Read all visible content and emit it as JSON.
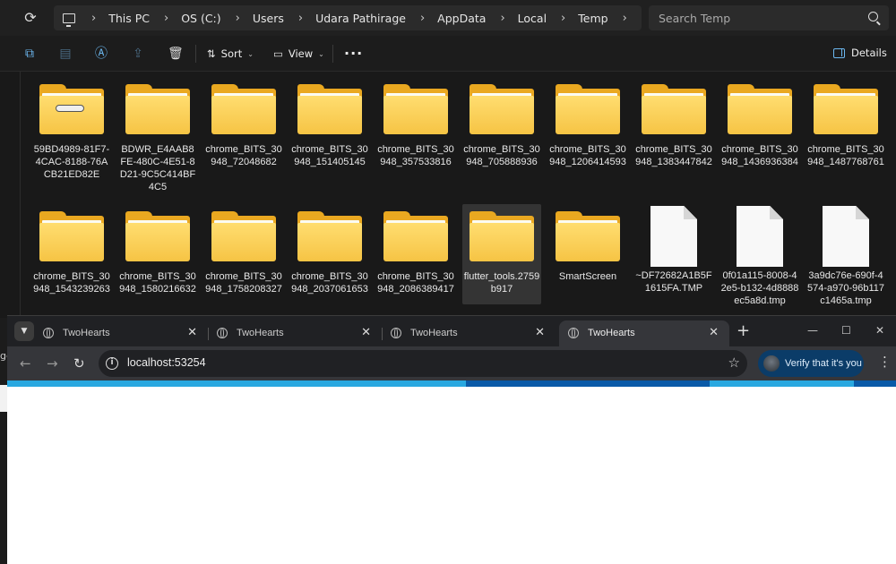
{
  "explorer": {
    "breadcrumb": [
      "This PC",
      "OS (C:)",
      "Users",
      "Udara Pathirage",
      "AppData",
      "Local",
      "Temp"
    ],
    "search_placeholder": "Search Temp",
    "toolbar": {
      "sort_label": "Sort",
      "view_label": "View",
      "details_label": "Details"
    },
    "items": [
      {
        "name": "59BD4989-81F7-4CAC-8188-76ACB21ED82E",
        "type": "folder-open"
      },
      {
        "name": "BDWR_E4AAB8FE-480C-4E51-8D21-9C5C414BF4C5",
        "type": "folder"
      },
      {
        "name": "chrome_BITS_30948_72048682",
        "type": "folder"
      },
      {
        "name": "chrome_BITS_30948_151405145",
        "type": "folder"
      },
      {
        "name": "chrome_BITS_30948_357533816",
        "type": "folder"
      },
      {
        "name": "chrome_BITS_30948_705888936",
        "type": "folder"
      },
      {
        "name": "chrome_BITS_30948_1206414593",
        "type": "folder"
      },
      {
        "name": "chrome_BITS_30948_1383447842",
        "type": "folder"
      },
      {
        "name": "chrome_BITS_30948_1436936384",
        "type": "folder"
      },
      {
        "name": "chrome_BITS_30948_1487768761",
        "type": "folder"
      },
      {
        "name": "chrome_BITS_30948_1543239263",
        "type": "folder"
      },
      {
        "name": "chrome_BITS_30948_1580216632",
        "type": "folder"
      },
      {
        "name": "chrome_BITS_30948_1758208327",
        "type": "folder"
      },
      {
        "name": "chrome_BITS_30948_2037061653",
        "type": "folder"
      },
      {
        "name": "chrome_BITS_30948_2086389417",
        "type": "folder"
      },
      {
        "name": "flutter_tools.2759b917",
        "type": "folder",
        "selected": true
      },
      {
        "name": "SmartScreen",
        "type": "folder"
      },
      {
        "name": "~DF72682A1B5F1615FA.TMP",
        "type": "file"
      },
      {
        "name": "0f01a115-8008-42e5-b132-4d8888ec5a8d.tmp",
        "type": "file"
      },
      {
        "name": "3a9dc76e-690f-4574-a970-96b117c1465a.tmp",
        "type": "file"
      }
    ]
  },
  "browser": {
    "tabs": [
      {
        "title": "TwoHearts",
        "active": false
      },
      {
        "title": "TwoHearts",
        "active": false
      },
      {
        "title": "TwoHearts",
        "active": false
      },
      {
        "title": "TwoHearts",
        "active": true
      }
    ],
    "url": "localhost:53254",
    "profile_button": "Verify that it's you",
    "loading_colors": [
      "#29a8e0",
      "#0a5aa8",
      "#29a8e0",
      "#0a5aa8"
    ]
  },
  "sliver_text": "ge"
}
